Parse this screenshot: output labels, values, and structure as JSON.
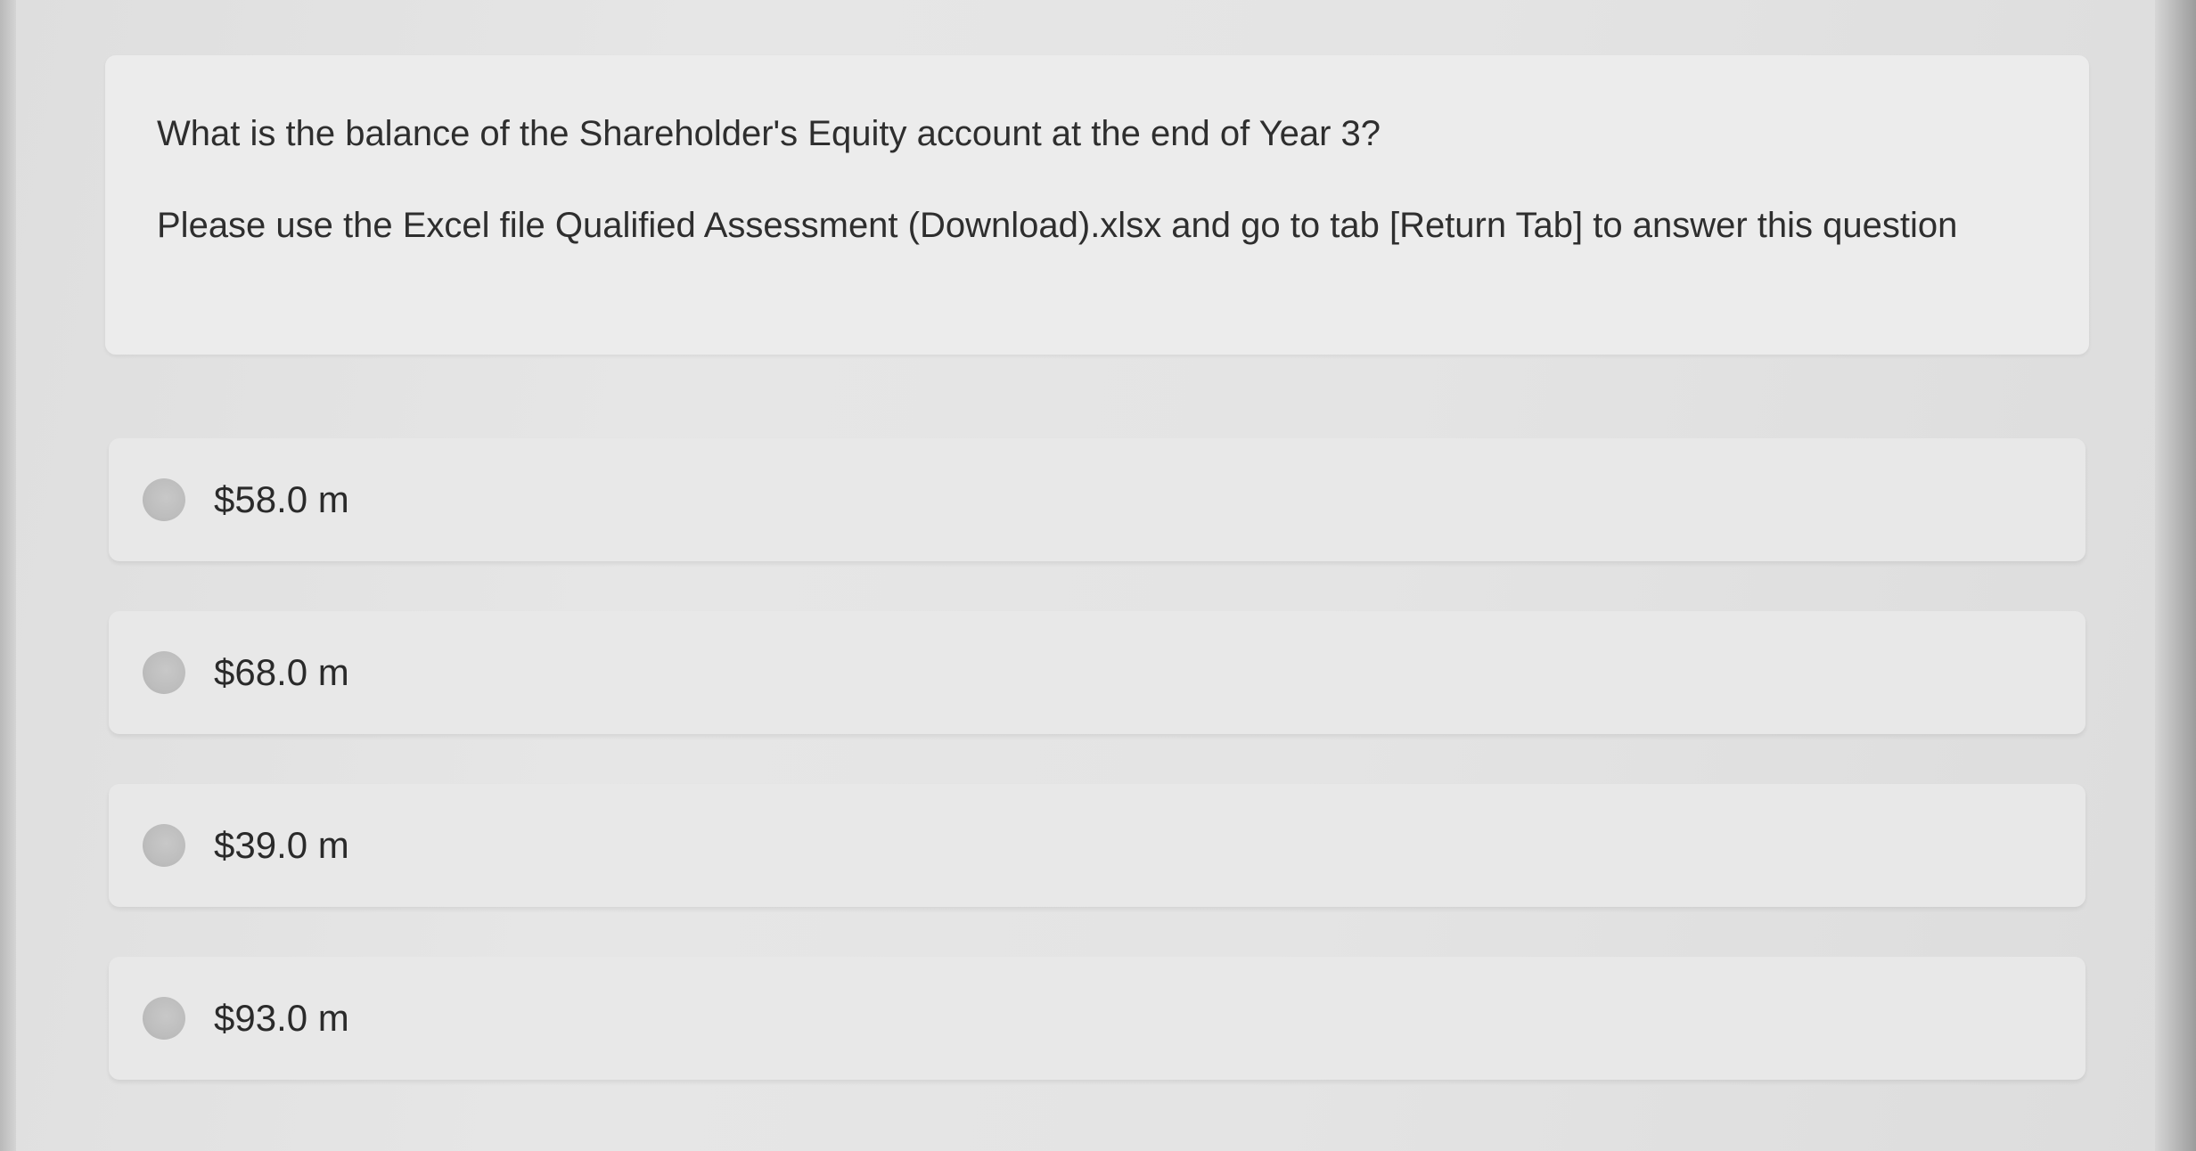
{
  "question": {
    "title": "What is the balance of the Shareholder's Equity account at the end of Year 3?",
    "instructions": "Please use the Excel file Qualified Assessment (Download).xlsx and go to tab [Return Tab] to answer this question"
  },
  "options": [
    {
      "label": "$58.0 m"
    },
    {
      "label": "$68.0 m"
    },
    {
      "label": "$39.0 m"
    },
    {
      "label": "$93.0 m"
    }
  ]
}
